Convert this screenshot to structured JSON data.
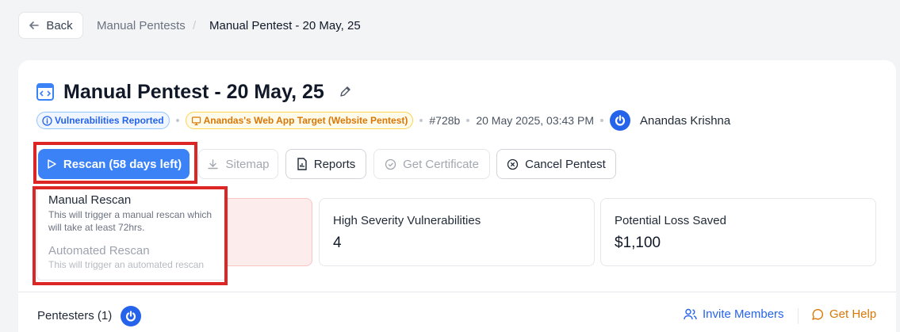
{
  "header": {
    "back_label": "Back",
    "breadcrumb": [
      "Manual Pentests",
      "/",
      "Manual Pentest - 20 May, 25"
    ]
  },
  "pentest": {
    "title": "Manual Pentest - 20 May, 25",
    "status_badge": "Vulnerabilities Reported",
    "target_badge": "Anandas's Web App Target (Website Pentest)",
    "id": "#728b",
    "datetime": "20 May 2025, 03:43 PM",
    "owner": "Anandas Krishna"
  },
  "actions": {
    "rescan": "Rescan (58 days left)",
    "sitemap": "Sitemap",
    "reports": "Reports",
    "certificate": "Get Certificate",
    "cancel": "Cancel Pentest"
  },
  "rescan_menu": [
    {
      "title": "Manual Rescan",
      "description": "This will trigger a manual rescan which will take at least 72hrs."
    },
    {
      "title": "Automated Rescan",
      "description": "This will trigger an automated rescan"
    }
  ],
  "stats": [
    {
      "label": "High Severity Vulnerabilities",
      "value": "4"
    },
    {
      "label": "Potential Loss Saved",
      "value": "$1,100"
    }
  ],
  "footer": {
    "pentesters_label": "Pentesters (1)",
    "invite_label": "Invite Members",
    "help_label": "Get Help"
  },
  "colors": {
    "accent": "#3b82f6",
    "highlight": "#dc2626",
    "help": "#d97706"
  }
}
